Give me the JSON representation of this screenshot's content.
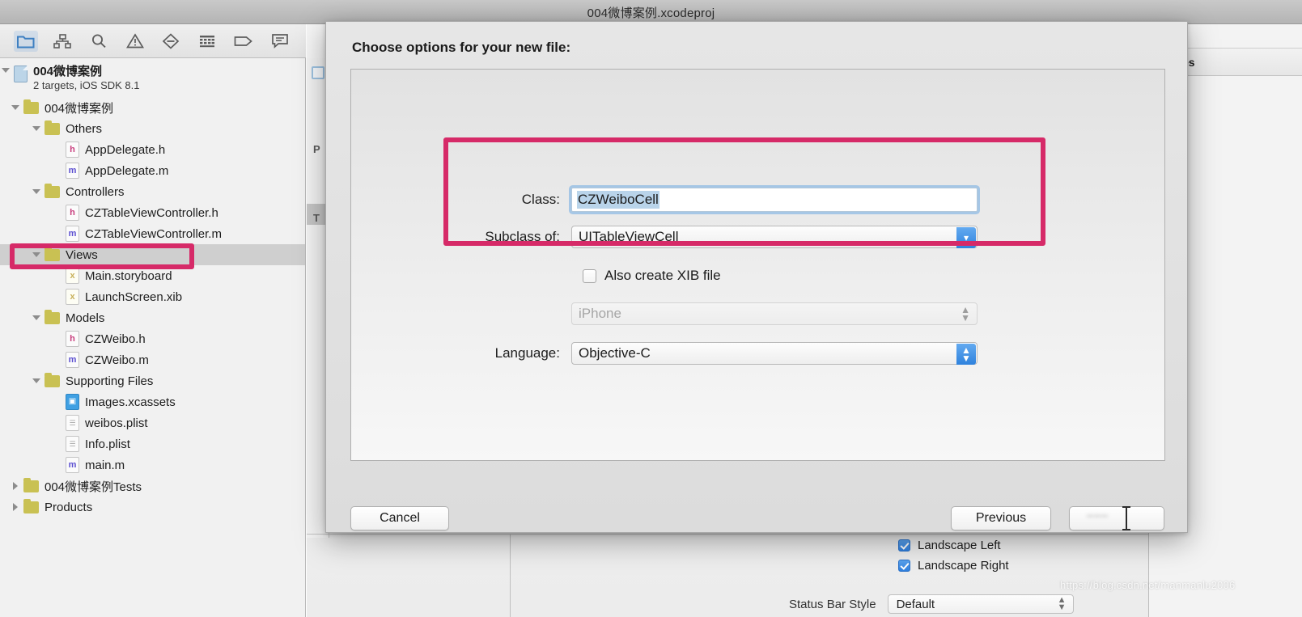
{
  "window": {
    "title": "004微博案例.xcodeproj"
  },
  "navigator_toolbar": {
    "icons": [
      {
        "name": "project-navigator-icon",
        "selected": true
      },
      {
        "name": "symbol-navigator-icon",
        "selected": false
      },
      {
        "name": "search-navigator-icon",
        "selected": false
      },
      {
        "name": "issue-navigator-icon",
        "selected": false
      },
      {
        "name": "test-navigator-icon",
        "selected": false
      },
      {
        "name": "debug-navigator-icon",
        "selected": false
      },
      {
        "name": "breakpoint-navigator-icon",
        "selected": false
      },
      {
        "name": "report-navigator-icon",
        "selected": false
      }
    ]
  },
  "navigator": {
    "project": {
      "name": "004微博案例",
      "subtitle": "2 targets, iOS SDK 8.1"
    },
    "items": [
      {
        "label": "004微博案例",
        "type": "folder",
        "indent": 1,
        "twisty": "down"
      },
      {
        "label": "Others",
        "type": "folder",
        "indent": 2,
        "twisty": "down"
      },
      {
        "label": "AppDelegate.h",
        "type": "h",
        "indent": 3,
        "twisty": "none"
      },
      {
        "label": "AppDelegate.m",
        "type": "m",
        "indent": 3,
        "twisty": "none"
      },
      {
        "label": "Controllers",
        "type": "folder",
        "indent": 2,
        "twisty": "down"
      },
      {
        "label": "CZTableViewController.h",
        "type": "h",
        "indent": 3,
        "twisty": "none"
      },
      {
        "label": "CZTableViewController.m",
        "type": "m",
        "indent": 3,
        "twisty": "none"
      },
      {
        "label": "Views",
        "type": "folder",
        "indent": 2,
        "twisty": "down",
        "selected": true
      },
      {
        "label": "Main.storyboard",
        "type": "sb",
        "indent": 3,
        "twisty": "none"
      },
      {
        "label": "LaunchScreen.xib",
        "type": "sb",
        "indent": 3,
        "twisty": "none"
      },
      {
        "label": "Models",
        "type": "folder",
        "indent": 2,
        "twisty": "down"
      },
      {
        "label": "CZWeibo.h",
        "type": "h",
        "indent": 3,
        "twisty": "none"
      },
      {
        "label": "CZWeibo.m",
        "type": "m",
        "indent": 3,
        "twisty": "none"
      },
      {
        "label": "Supporting Files",
        "type": "folder",
        "indent": 2,
        "twisty": "down"
      },
      {
        "label": "Images.xcassets",
        "type": "xcassets",
        "indent": 3,
        "twisty": "none"
      },
      {
        "label": "weibos.plist",
        "type": "plist",
        "indent": 3,
        "twisty": "none"
      },
      {
        "label": "Info.plist",
        "type": "plist",
        "indent": 3,
        "twisty": "none"
      },
      {
        "label": "main.m",
        "type": "m",
        "indent": 3,
        "twisty": "none"
      },
      {
        "label": "004微博案例Tests",
        "type": "folder",
        "indent": 1,
        "twisty": "right"
      },
      {
        "label": "Products",
        "type": "folder",
        "indent": 1,
        "twisty": "right"
      }
    ]
  },
  "editor_background": {
    "mini_pane_letters": [
      "P",
      "T"
    ],
    "right_tab_label": "d Rules"
  },
  "dialog": {
    "title": "Choose options for your new file:",
    "class_label": "Class:",
    "class_value": "CZWeiboCell",
    "subclass_label": "Subclass of:",
    "subclass_value": "UITableViewCell",
    "xib_checkbox_label": "Also create XIB file",
    "xib_checked": false,
    "device_value": "iPhone",
    "device_enabled": false,
    "language_label": "Language:",
    "language_value": "Objective-C",
    "cancel_label": "Cancel",
    "previous_label": "Previous",
    "next_label": "Next"
  },
  "device_orientation": {
    "items": [
      {
        "label": "Landscape Left",
        "checked": true
      },
      {
        "label": "Landscape Right",
        "checked": true
      }
    ]
  },
  "status_bar": {
    "label": "Status Bar Style",
    "value": "Default"
  },
  "watermark": {
    "text": "https://blog.csdn.net/manmanlu2006"
  },
  "colors": {
    "annotation_pink": "#d62a68",
    "accent_blue": "#2f82dd",
    "folder_yellow": "#c9c153",
    "header_icon_blue": "#bcd5e8"
  }
}
